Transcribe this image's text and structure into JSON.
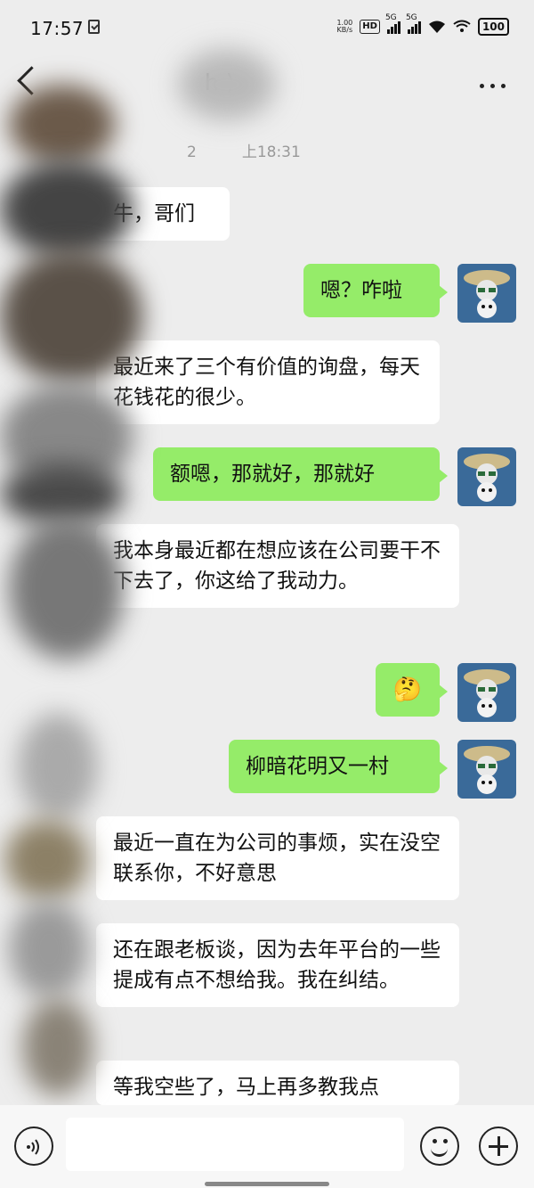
{
  "status_bar": {
    "time": "17:57",
    "net_speed_value": "1.00",
    "net_speed_unit": "KB/s",
    "hd_label": "HD",
    "signal1_label": "5G",
    "signal2_label": "5G",
    "battery": "100"
  },
  "header": {
    "title": "h )"
  },
  "chat": {
    "timestamp": "2　　　上18:31",
    "messages": [
      {
        "side": "in",
        "text": "牛，哥们"
      },
      {
        "side": "out",
        "text": "嗯？咋啦"
      },
      {
        "side": "in",
        "text": "最近来了三个有价值的询盘，每天花钱花的很少。"
      },
      {
        "side": "out",
        "text": "额嗯，那就好，那就好"
      },
      {
        "side": "in",
        "text": "我本身最近都在想应该在公司要干不下去了，你这给了我动力。"
      },
      {
        "side": "out",
        "text": "🤔"
      },
      {
        "side": "out",
        "text": "柳暗花明又一村"
      },
      {
        "side": "in",
        "text": "最近一直在为公司的事烦，实在没空联系你，不好意思"
      },
      {
        "side": "in",
        "text": "还在跟老板谈，因为去年平台的一些提成有点不想给我。我在纠结。"
      },
      {
        "side": "in",
        "text": "等我空些了，马上再多教我点"
      }
    ]
  },
  "icons": {
    "back": "chevron-left-icon",
    "more": "more-horizontal-icon",
    "voice": "voice-icon",
    "emoji": "emoji-icon",
    "plus": "plus-icon"
  },
  "colors": {
    "background": "#ededed",
    "bubble_out": "#95ec69",
    "bubble_in": "#ffffff",
    "timestamp": "#999999"
  }
}
